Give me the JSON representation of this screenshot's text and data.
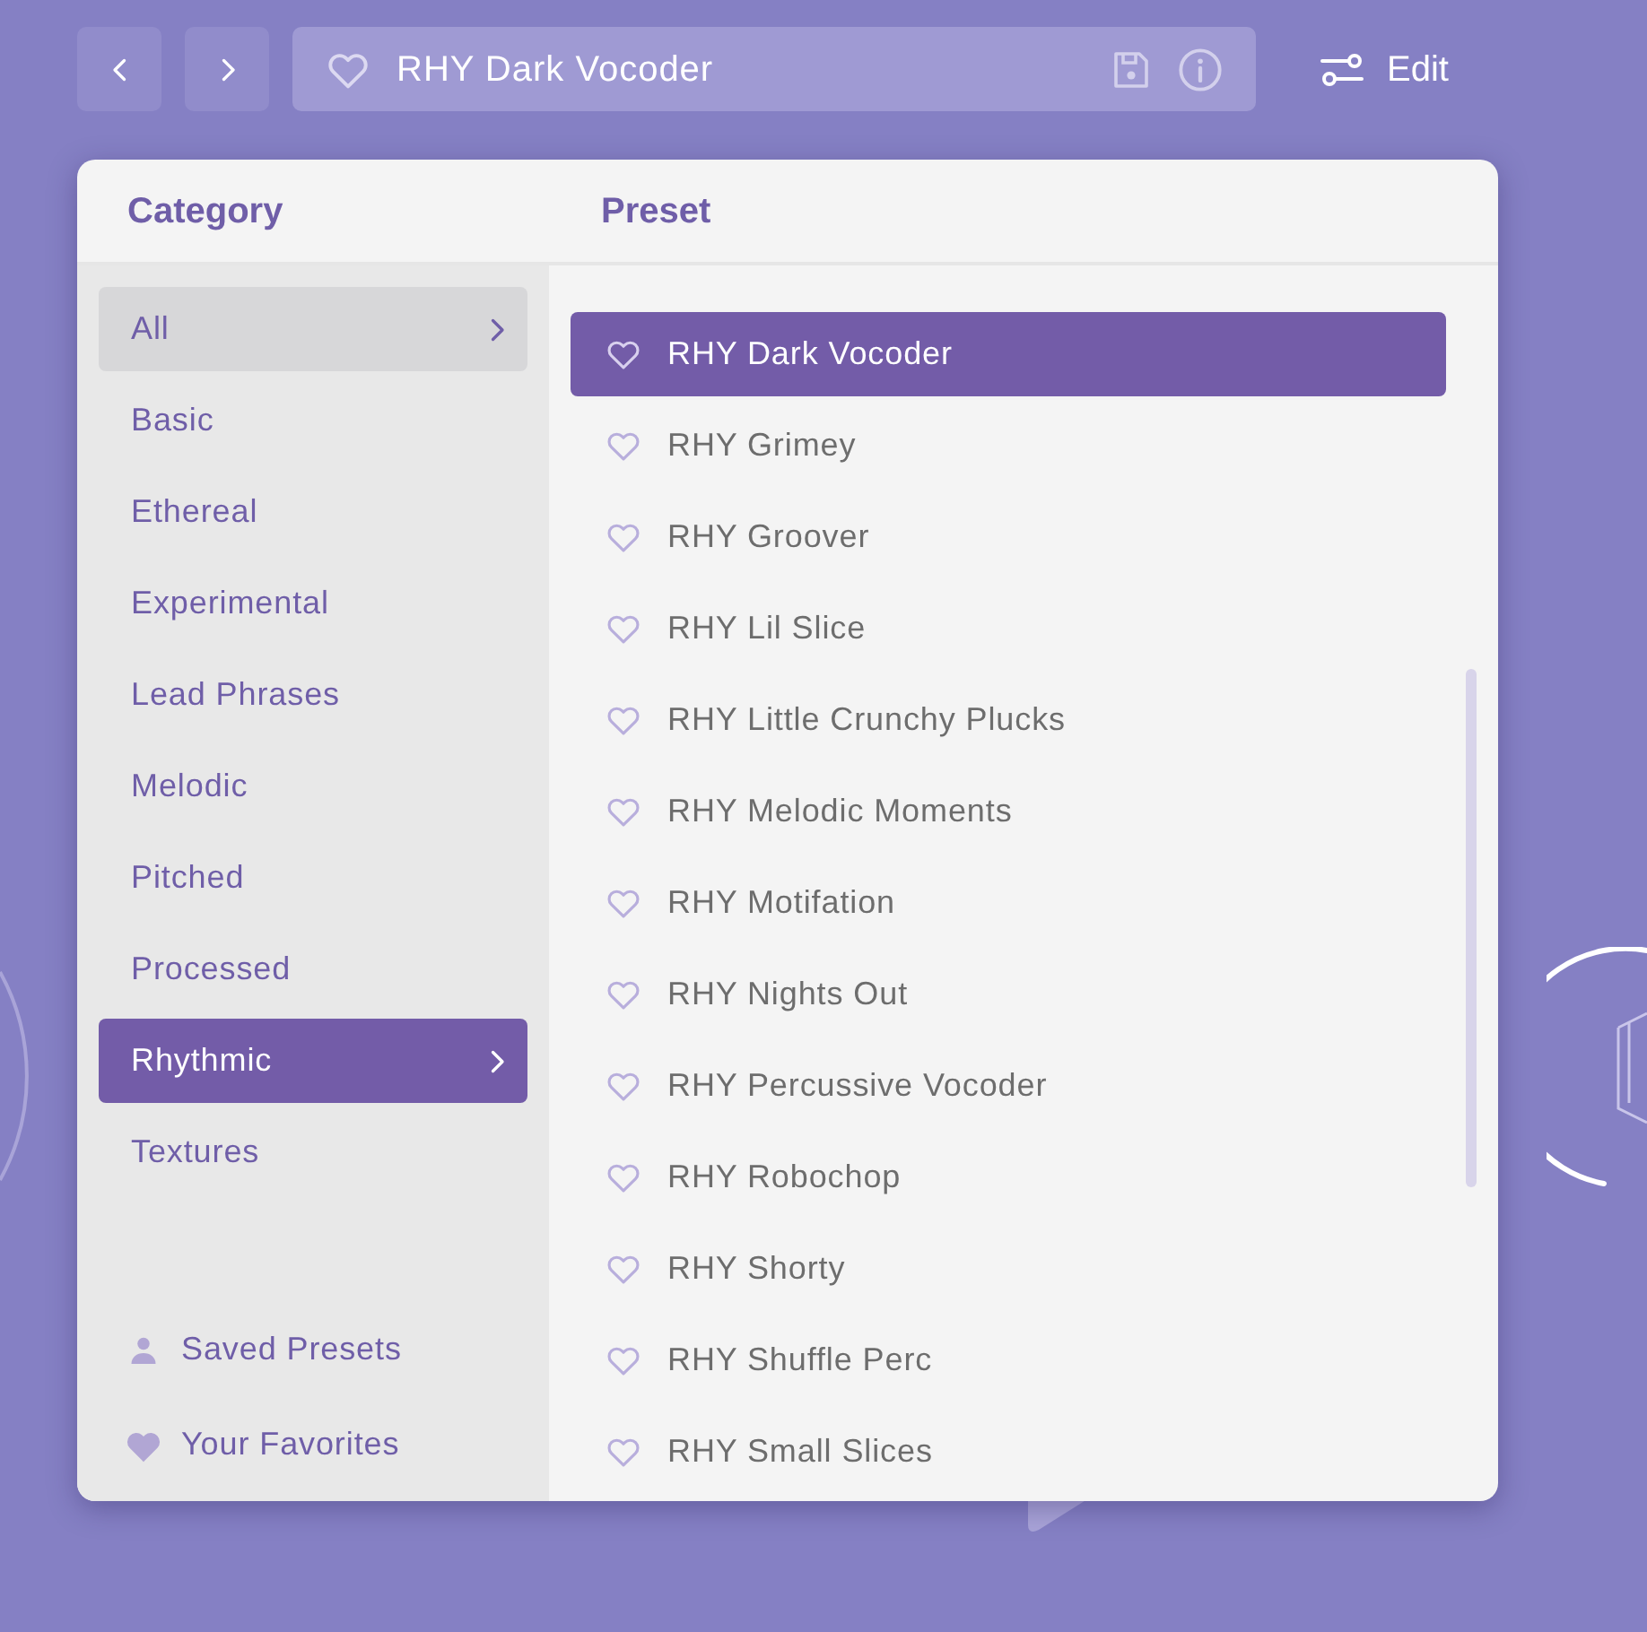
{
  "header": {
    "preset_name": "RHY Dark Vocoder",
    "favorite": false,
    "edit_label": "Edit"
  },
  "browser": {
    "category_heading": "Category",
    "preset_heading": "Preset",
    "categories": [
      {
        "label": "All",
        "selected": false,
        "highlighted": true
      },
      {
        "label": "Basic",
        "selected": false,
        "highlighted": false
      },
      {
        "label": "Ethereal",
        "selected": false,
        "highlighted": false
      },
      {
        "label": "Experimental",
        "selected": false,
        "highlighted": false
      },
      {
        "label": "Lead Phrases",
        "selected": false,
        "highlighted": false
      },
      {
        "label": "Melodic",
        "selected": false,
        "highlighted": false
      },
      {
        "label": "Pitched",
        "selected": false,
        "highlighted": false
      },
      {
        "label": "Processed",
        "selected": false,
        "highlighted": false
      },
      {
        "label": "Rhythmic",
        "selected": true,
        "highlighted": false
      },
      {
        "label": "Textures",
        "selected": false,
        "highlighted": false
      }
    ],
    "links": [
      {
        "kind": "person",
        "label": "Saved Presets"
      },
      {
        "kind": "heart",
        "label": "Your Favorites"
      }
    ],
    "presets": [
      {
        "label": "RHY Dark Vocoder",
        "selected": true,
        "favorite": false
      },
      {
        "label": "RHY Grimey",
        "selected": false,
        "favorite": false
      },
      {
        "label": "RHY Groover",
        "selected": false,
        "favorite": false
      },
      {
        "label": "RHY Lil Slice",
        "selected": false,
        "favorite": false
      },
      {
        "label": "RHY Little Crunchy Plucks",
        "selected": false,
        "favorite": false
      },
      {
        "label": "RHY Melodic Moments",
        "selected": false,
        "favorite": false
      },
      {
        "label": "RHY Motifation",
        "selected": false,
        "favorite": false
      },
      {
        "label": "RHY Nights Out",
        "selected": false,
        "favorite": false
      },
      {
        "label": "RHY Percussive Vocoder",
        "selected": false,
        "favorite": false
      },
      {
        "label": "RHY Robochop",
        "selected": false,
        "favorite": false
      },
      {
        "label": "RHY Shorty",
        "selected": false,
        "favorite": false
      },
      {
        "label": "RHY Shuffle Perc",
        "selected": false,
        "favorite": false
      },
      {
        "label": "RHY Small Slices",
        "selected": false,
        "favorite": false
      }
    ]
  }
}
